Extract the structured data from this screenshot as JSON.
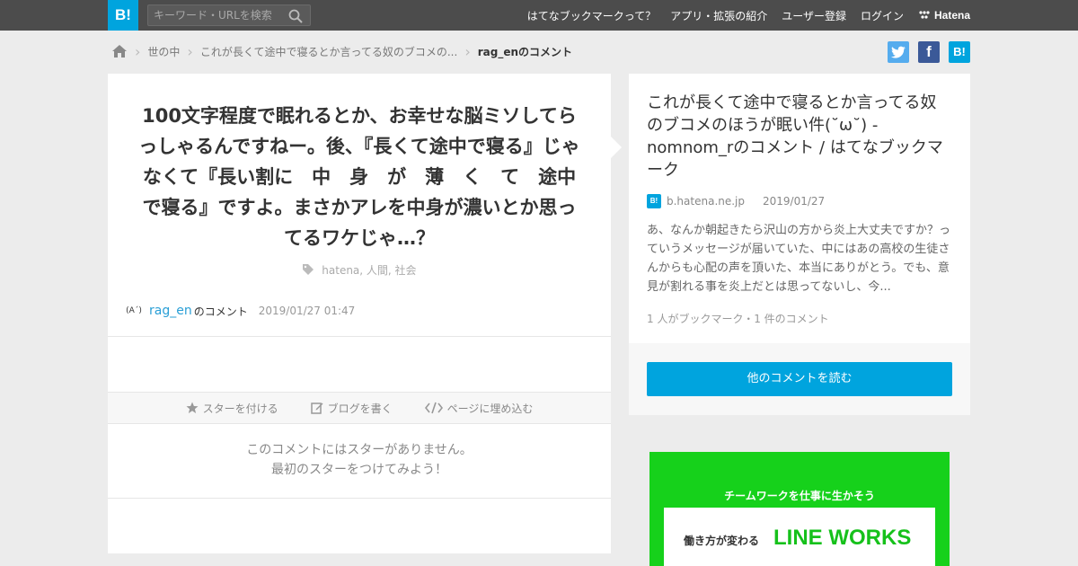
{
  "header": {
    "logo": "B!",
    "search_placeholder": "キーワード・URLを検索",
    "nav": [
      "はてなブックマークって？",
      "アプリ・拡張の紹介",
      "ユーザー登録",
      "ログイン"
    ],
    "brand": "Hatena"
  },
  "breadcrumb": {
    "items": [
      "世の中",
      "これが長くて途中で寝るとか言ってる奴のブコメの..."
    ],
    "current": "rag_enのコメント"
  },
  "share": {
    "twitter": "t",
    "facebook": "f",
    "hatena": "B!"
  },
  "comment": {
    "text": "100文字程度で眠れるとか、お幸せな脳ミソしてらっしゃるんですねー。後、『長くて途中で寝る』じゃなくて『長い割に　中　身　が　薄　く　て　途中で寝る』ですよ。まさかアレを中身が濃いとか思ってるワケじゃ…？",
    "tags": "hatena,  人間,  社会",
    "avatar_text": "(A´)",
    "user": "rag_en",
    "user_suffix": "のコメント",
    "date": "2019/01/27 01:47"
  },
  "actions": {
    "star": "スターを付ける",
    "blog": "ブログを書く",
    "embed": "ページに埋め込む"
  },
  "nostar": {
    "line1": "このコメントにはスターがありません。",
    "line2": "最初のスターをつけてみよう！"
  },
  "entry": {
    "title": "これが長くて途中で寝るとか言ってる奴のブコメのほうが眠い件(˘ω˘) - nomnom_rのコメント / はてなブックマーク",
    "favicon": "B!",
    "domain": "b.hatena.ne.jp",
    "date": "2019/01/27",
    "excerpt": "あ、なんか朝起きたら沢山の方から炎上大丈夫ですか？っていうメッセージが届いていた、中にはあの高校の生徒さんからも心配の声を頂いた、本当にありがとう。でも、意見が割れる事を炎上だとは思ってないし、今...",
    "counts": "1 人がブックマーク・1 件のコメント",
    "read_more": "他のコメントを読む"
  },
  "ad": {
    "tagline": "チームワークを仕事に生かそう",
    "sub": "働き方が変わる",
    "brand": "LINE WORKS"
  },
  "colors": {
    "accent": "#00a4de",
    "header": "#4c4c4c",
    "ad_green": "#16d11b"
  }
}
